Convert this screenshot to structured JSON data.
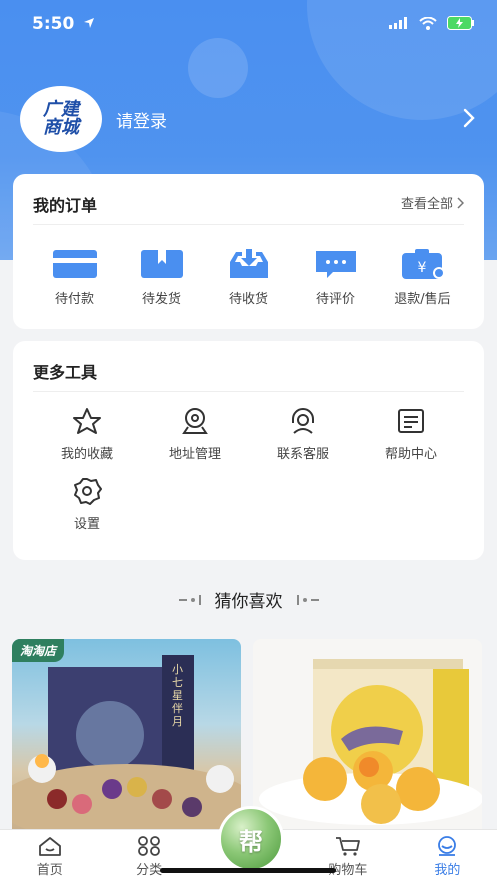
{
  "status_bar": {
    "time": "5:50"
  },
  "profile": {
    "login_label": "请登录",
    "logo_text_1": "广建",
    "logo_text_2": "商城"
  },
  "orders": {
    "title": "我的订单",
    "view_all": "查看全部",
    "items": [
      {
        "label": "待付款",
        "icon": "wallet-icon"
      },
      {
        "label": "待发货",
        "icon": "package-icon"
      },
      {
        "label": "待收货",
        "icon": "inbox-download-icon"
      },
      {
        "label": "待评价",
        "icon": "chat-bubble-icon"
      },
      {
        "label": "退款/售后",
        "icon": "refund-icon"
      }
    ]
  },
  "tools": {
    "title": "更多工具",
    "items": [
      {
        "label": "我的收藏",
        "icon": "star-icon"
      },
      {
        "label": "地址管理",
        "icon": "location-icon"
      },
      {
        "label": "联系客服",
        "icon": "headset-icon"
      },
      {
        "label": "帮助中心",
        "icon": "help-document-icon"
      },
      {
        "label": "设置",
        "icon": "settings-gear-icon"
      }
    ]
  },
  "recommend": {
    "title": "猜你喜欢",
    "products": [
      {
        "shop_tag": "淘淘店",
        "box_title": "小七星伴月"
      },
      {
        "box_title": ""
      }
    ]
  },
  "tabbar": {
    "items": [
      {
        "label": "首页",
        "icon": "home-icon"
      },
      {
        "label": "分类",
        "icon": "category-icon"
      },
      {
        "label": "",
        "icon": "help-center-button"
      },
      {
        "label": "购物车",
        "icon": "cart-icon"
      },
      {
        "label": "我的",
        "icon": "profile-icon",
        "active": true
      }
    ],
    "center_label": "帮"
  },
  "colors": {
    "primary": "#3a7de6",
    "header": "#4a8ff0"
  }
}
